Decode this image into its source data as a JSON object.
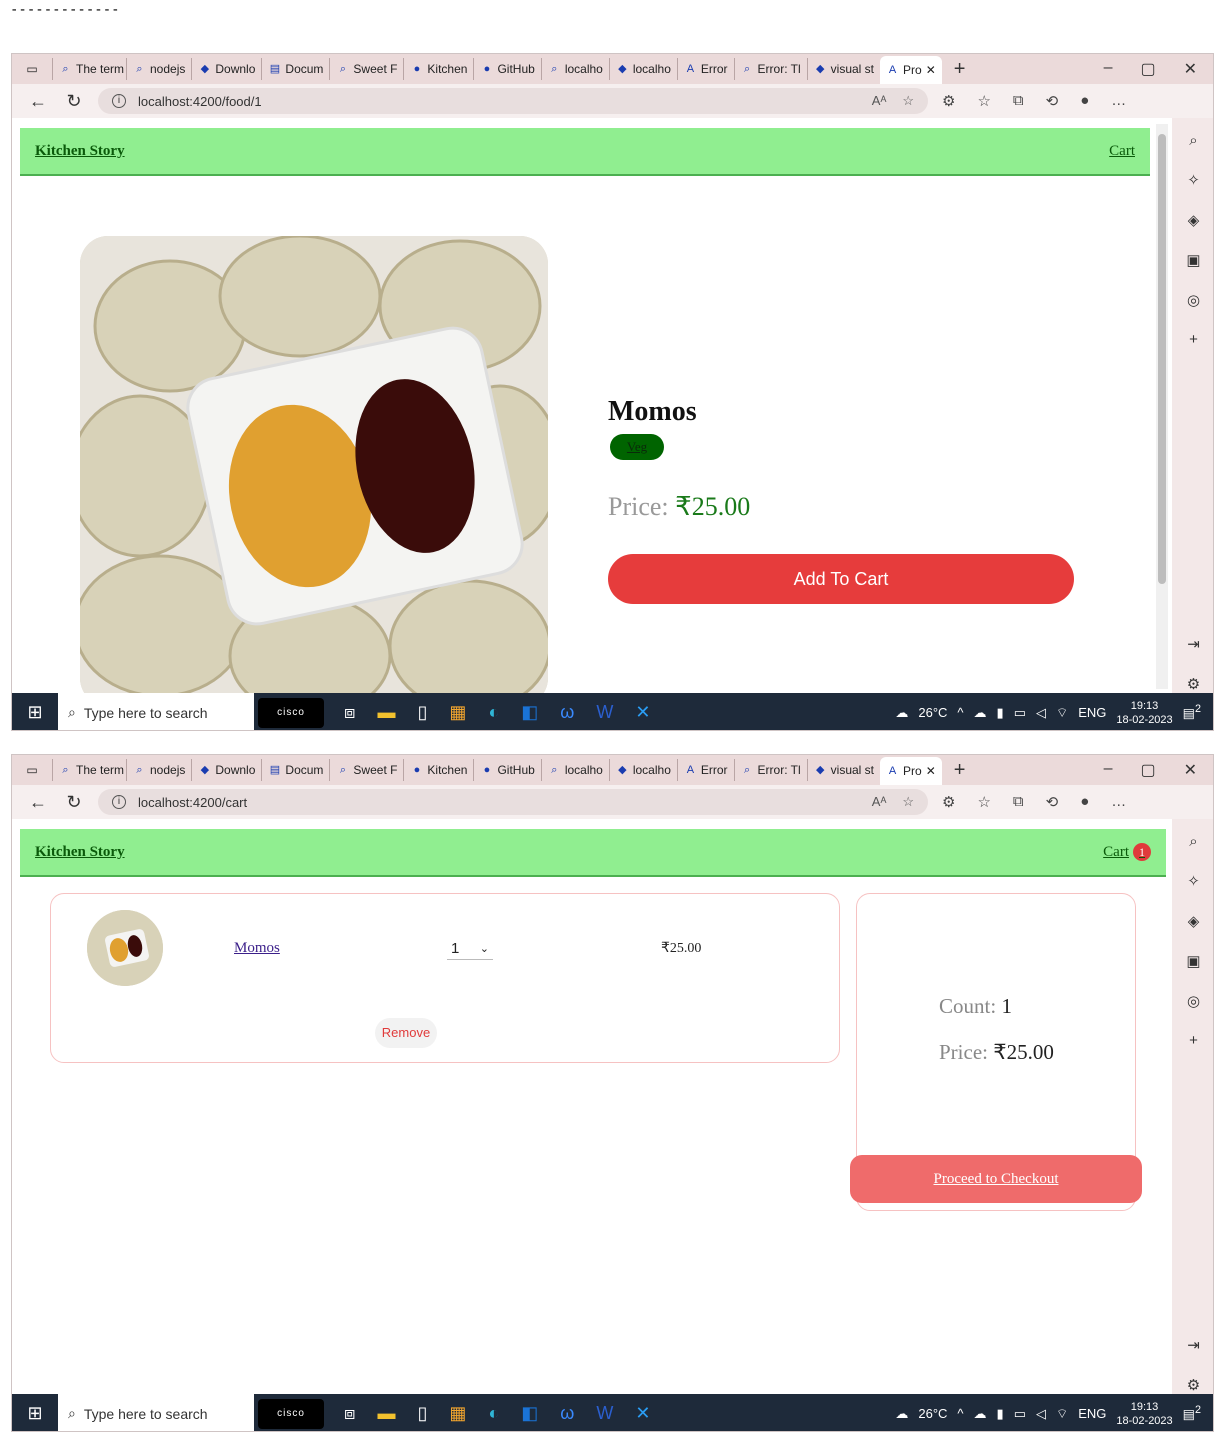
{
  "separator": "-------------",
  "browser": {
    "tabs": [
      {
        "label": "The term",
        "icon": "search-icon"
      },
      {
        "label": "nodejs",
        "icon": "search-icon"
      },
      {
        "label": "Downlo",
        "icon": "nodejs-icon"
      },
      {
        "label": "Docum",
        "icon": "pdf-icon"
      },
      {
        "label": "Sweet F",
        "icon": "search-icon"
      },
      {
        "label": "Kitchen",
        "icon": "github-icon"
      },
      {
        "label": "GitHub",
        "icon": "github-icon"
      },
      {
        "label": "localho",
        "icon": "search-icon"
      },
      {
        "label": "localho",
        "icon": "app-icon"
      },
      {
        "label": "Error",
        "icon": "angular-icon"
      },
      {
        "label": "Error: Tl",
        "icon": "search-icon"
      },
      {
        "label": "visual st",
        "icon": "stackoverflow-icon"
      }
    ],
    "active_tab": "Pro",
    "new_tab": "+",
    "read_aloud": "Aᴬ"
  },
  "shot1": {
    "url": "localhost:4200/food/1",
    "brand": "Kitchen Story",
    "cart_link": "Cart",
    "food": {
      "name": "Momos",
      "tag": "Veg",
      "price_label": "Price:",
      "price": "₹25.00",
      "add_button": "Add To Cart"
    }
  },
  "shot2": {
    "url": "localhost:4200/cart",
    "brand": "Kitchen Story",
    "cart_link": "Cart",
    "cart_count": "1",
    "item": {
      "name": "Momos",
      "quantity": "1",
      "price": "₹25.00",
      "remove": "Remove"
    },
    "summary": {
      "count_label": "Count:",
      "count": "1",
      "price_label": "Price:",
      "price": "₹25.00",
      "checkout": "Proceed to Checkout"
    }
  },
  "taskbar": {
    "search_placeholder": "Type here to search",
    "cisco": "cisco",
    "temperature": "26°C",
    "language": "ENG",
    "time": "19:13",
    "date": "18-02-2023",
    "notifications": "2"
  },
  "colors": {
    "header_bg": "#90ee90",
    "accent_red": "#e63c3c",
    "veg_green": "#006400",
    "checkout_bg": "#ef6b6b"
  }
}
